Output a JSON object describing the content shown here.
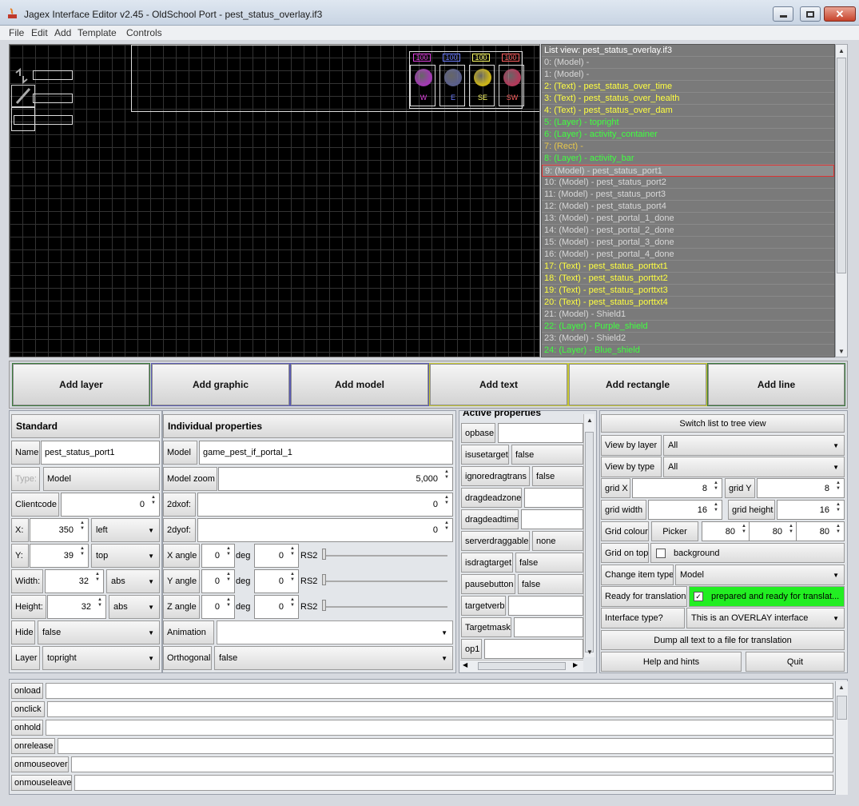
{
  "window": {
    "title": "Jagex Interface Editor v2.45 - OldSchool Port - pest_status_overlay.if3"
  },
  "menu": [
    "File",
    "Edit",
    "Add",
    "Template",
    "Controls"
  ],
  "canvas": {
    "counters": [
      "100",
      "100",
      "100",
      "100"
    ],
    "counter_colors": [
      "#e040e0",
      "#6c7cff",
      "#ffff66",
      "#ff6060"
    ],
    "shield_colors": [
      "#a03ab0",
      "#5a5f8a",
      "#c9b21a",
      "#b03a5a"
    ],
    "shield_labels": [
      "W",
      "E",
      "SE",
      "SW"
    ]
  },
  "listview": {
    "header": "List view: pest_status_overlay.if3",
    "items": [
      {
        "t": "0: (Model) -",
        "c": "#d8d8d8"
      },
      {
        "t": "1: (Model) -",
        "c": "#d8d8d8"
      },
      {
        "t": "2: (Text) - pest_status_over_time",
        "c": "#ffff40"
      },
      {
        "t": "3: (Text) - pest_status_over_health",
        "c": "#ffff40"
      },
      {
        "t": "4: (Text) - pest_status_over_dam",
        "c": "#ffff40"
      },
      {
        "t": "5: (Layer) - topright",
        "c": "#40ff40"
      },
      {
        "t": "6: (Layer) - activity_container",
        "c": "#40ff40"
      },
      {
        "t": "7: (Rect) -",
        "c": "#e6c74a"
      },
      {
        "t": "8: (Layer) - activity_bar",
        "c": "#40ff40"
      },
      {
        "t": "9: (Model) - pest_status_port1",
        "c": "#d8d8d8",
        "selected": true
      },
      {
        "t": "10: (Model) - pest_status_port2",
        "c": "#d8d8d8"
      },
      {
        "t": "11: (Model) - pest_status_port3",
        "c": "#d8d8d8"
      },
      {
        "t": "12: (Model) - pest_status_port4",
        "c": "#d8d8d8"
      },
      {
        "t": "13: (Model) - pest_portal_1_done",
        "c": "#d8d8d8"
      },
      {
        "t": "14: (Model) - pest_portal_2_done",
        "c": "#d8d8d8"
      },
      {
        "t": "15: (Model) - pest_portal_3_done",
        "c": "#d8d8d8"
      },
      {
        "t": "16: (Model) - pest_portal_4_done",
        "c": "#d8d8d8"
      },
      {
        "t": "17: (Text) - pest_status_porttxt1",
        "c": "#ffff40"
      },
      {
        "t": "18: (Text) - pest_status_porttxt2",
        "c": "#ffff40"
      },
      {
        "t": "19: (Text) - pest_status_porttxt3",
        "c": "#ffff40"
      },
      {
        "t": "20: (Text) - pest_status_porttxt4",
        "c": "#ffff40"
      },
      {
        "t": "21: (Model) - Shield1",
        "c": "#d8d8d8"
      },
      {
        "t": "22: (Layer) - Purple_shield",
        "c": "#40ff40"
      },
      {
        "t": "23: (Model) - Shield2",
        "c": "#d8d8d8"
      },
      {
        "t": "24: (Layer) - Blue_shield",
        "c": "#40ff40"
      }
    ]
  },
  "addbar": [
    "Add layer",
    "Add graphic",
    "Add model",
    "Add text",
    "Add rectangle",
    "Add line"
  ],
  "addbar_borders": [
    "#3a7a3a",
    "#5a5ab0",
    "#5a5ab0",
    "#c8c832",
    "#c8c832",
    "#3a7a3a"
  ],
  "standard": {
    "header": "Standard",
    "name_label": "Name",
    "name": "pest_status_port1",
    "type_label": "Type:",
    "type": "Model",
    "clientcode_label": "Clientcode",
    "clientcode": "0",
    "x_label": "X:",
    "x": "350",
    "x_mode": "left",
    "y_label": "Y:",
    "y": "39",
    "y_mode": "top",
    "width_label": "Width:",
    "width": "32",
    "width_mode": "abs",
    "height_label": "Height:",
    "height": "32",
    "height_mode": "abs",
    "hide_label": "Hide",
    "hide": "false",
    "layer_label": "Layer",
    "layer": "topright"
  },
  "individual": {
    "header": "Individual properties",
    "model_label": "Model",
    "model": "game_pest_if_portal_1",
    "zoom_label": "Model zoom",
    "zoom": "5,000",
    "dx_label": "2dxof:",
    "dx": "0",
    "dy_label": "2dyof:",
    "dy": "0",
    "xangle_label": "X angle",
    "yangle_label": "Y angle",
    "zangle_label": "Z angle",
    "deg_label": "deg",
    "rs2_label": "RS2",
    "xdeg": "0",
    "xrs": "0",
    "ydeg": "0",
    "yrs": "0",
    "zdeg": "0",
    "zrs": "0",
    "anim_label": "Animation",
    "anim": "",
    "ortho_label": "Orthogonal",
    "ortho": "false"
  },
  "active": {
    "header": "Active properties",
    "rows": [
      {
        "l": "opbase",
        "v": "",
        "type": "field"
      },
      {
        "l": "isusetarget",
        "v": "false",
        "type": "drop"
      },
      {
        "l": "ignoredragtrans",
        "v": "false",
        "type": "drop"
      },
      {
        "l": "dragdeadzone",
        "v": "",
        "type": "field"
      },
      {
        "l": "dragdeadtime",
        "v": "",
        "type": "field"
      },
      {
        "l": "serverdraggable",
        "v": "none",
        "type": "drop"
      },
      {
        "l": "isdragtarget",
        "v": "false",
        "type": "drop"
      },
      {
        "l": "pausebutton",
        "v": "false",
        "type": "drop"
      },
      {
        "l": "targetverb",
        "v": "",
        "type": "field"
      },
      {
        "l": "Targetmask",
        "v": "",
        "type": "field"
      },
      {
        "l": "op1",
        "v": "",
        "type": "field"
      }
    ]
  },
  "settings": {
    "switch": "Switch list to tree view",
    "view_layer_label": "View by layer",
    "view_layer": "All",
    "view_type_label": "View by type",
    "view_type": "All",
    "gridx_label": "grid X",
    "gridx": "8",
    "gridy_label": "grid Y",
    "gridy": "8",
    "gridw_label": "grid width",
    "gridw": "16",
    "gridh_label": "grid height",
    "gridh": "16",
    "gridc_label": "Grid colour",
    "picker": "Picker",
    "r": "80",
    "g": "80",
    "b": "80",
    "gridtop_label": "Grid on top",
    "background": "background",
    "change_label": "Change item type",
    "change": "Model",
    "ready_label": "Ready for translation",
    "ready": "prepared and ready for translat...",
    "ready_color": "#22ee22",
    "iftype_label": "Interface type?",
    "iftype": "This is an OVERLAY interface",
    "dump": "Dump all text to a file for translation",
    "help": "Help and hints",
    "quit": "Quit"
  },
  "events": [
    "onload",
    "onclick",
    "onhold",
    "onrelease",
    "onmouseover",
    "onmouseleave"
  ]
}
